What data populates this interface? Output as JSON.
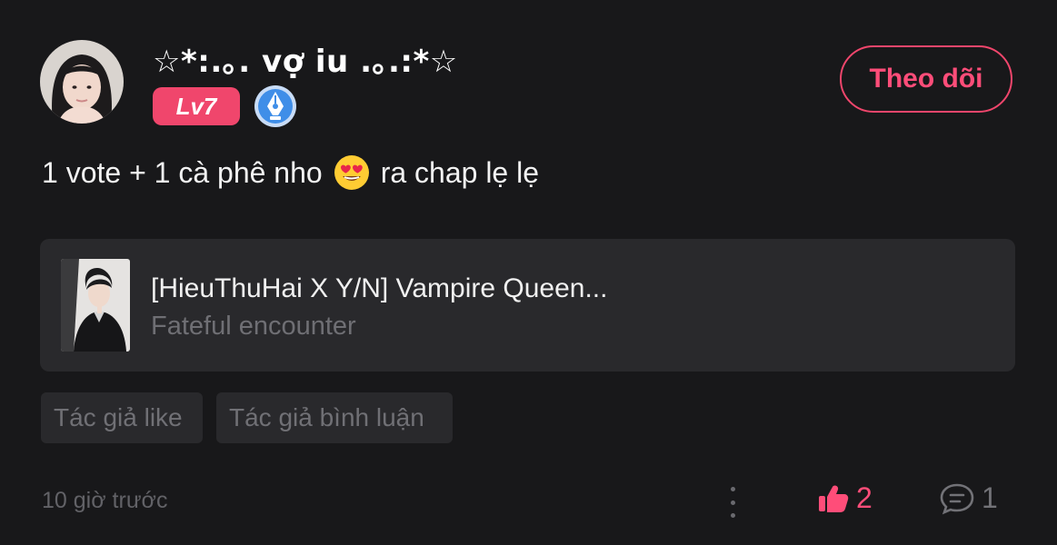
{
  "author": {
    "name": "☆*:.｡. vợ iu .｡.:*☆",
    "level": "Lv7",
    "badge_icon": "pen-badge-icon",
    "avatar_icon": "user-avatar"
  },
  "follow_button": {
    "label": "Theo dõi"
  },
  "post": {
    "text_before": "1 vote + 1 cà phê nho",
    "emoji_icon": "heart-eyes-emoji",
    "text_after": "ra chap lẹ lẹ"
  },
  "story": {
    "title": "[HieuThuHai X Y/N] Vampire Queen...",
    "subtitle": "Fateful encounter"
  },
  "tags": [
    "Tác giả like",
    "Tác giả bình luận"
  ],
  "footer": {
    "timestamp": "10 giờ trước",
    "likes": "2",
    "comments": "1"
  },
  "colors": {
    "accent": "#ff4d79",
    "background": "#18181a",
    "card": "#29292c",
    "muted": "#6f6f74"
  }
}
